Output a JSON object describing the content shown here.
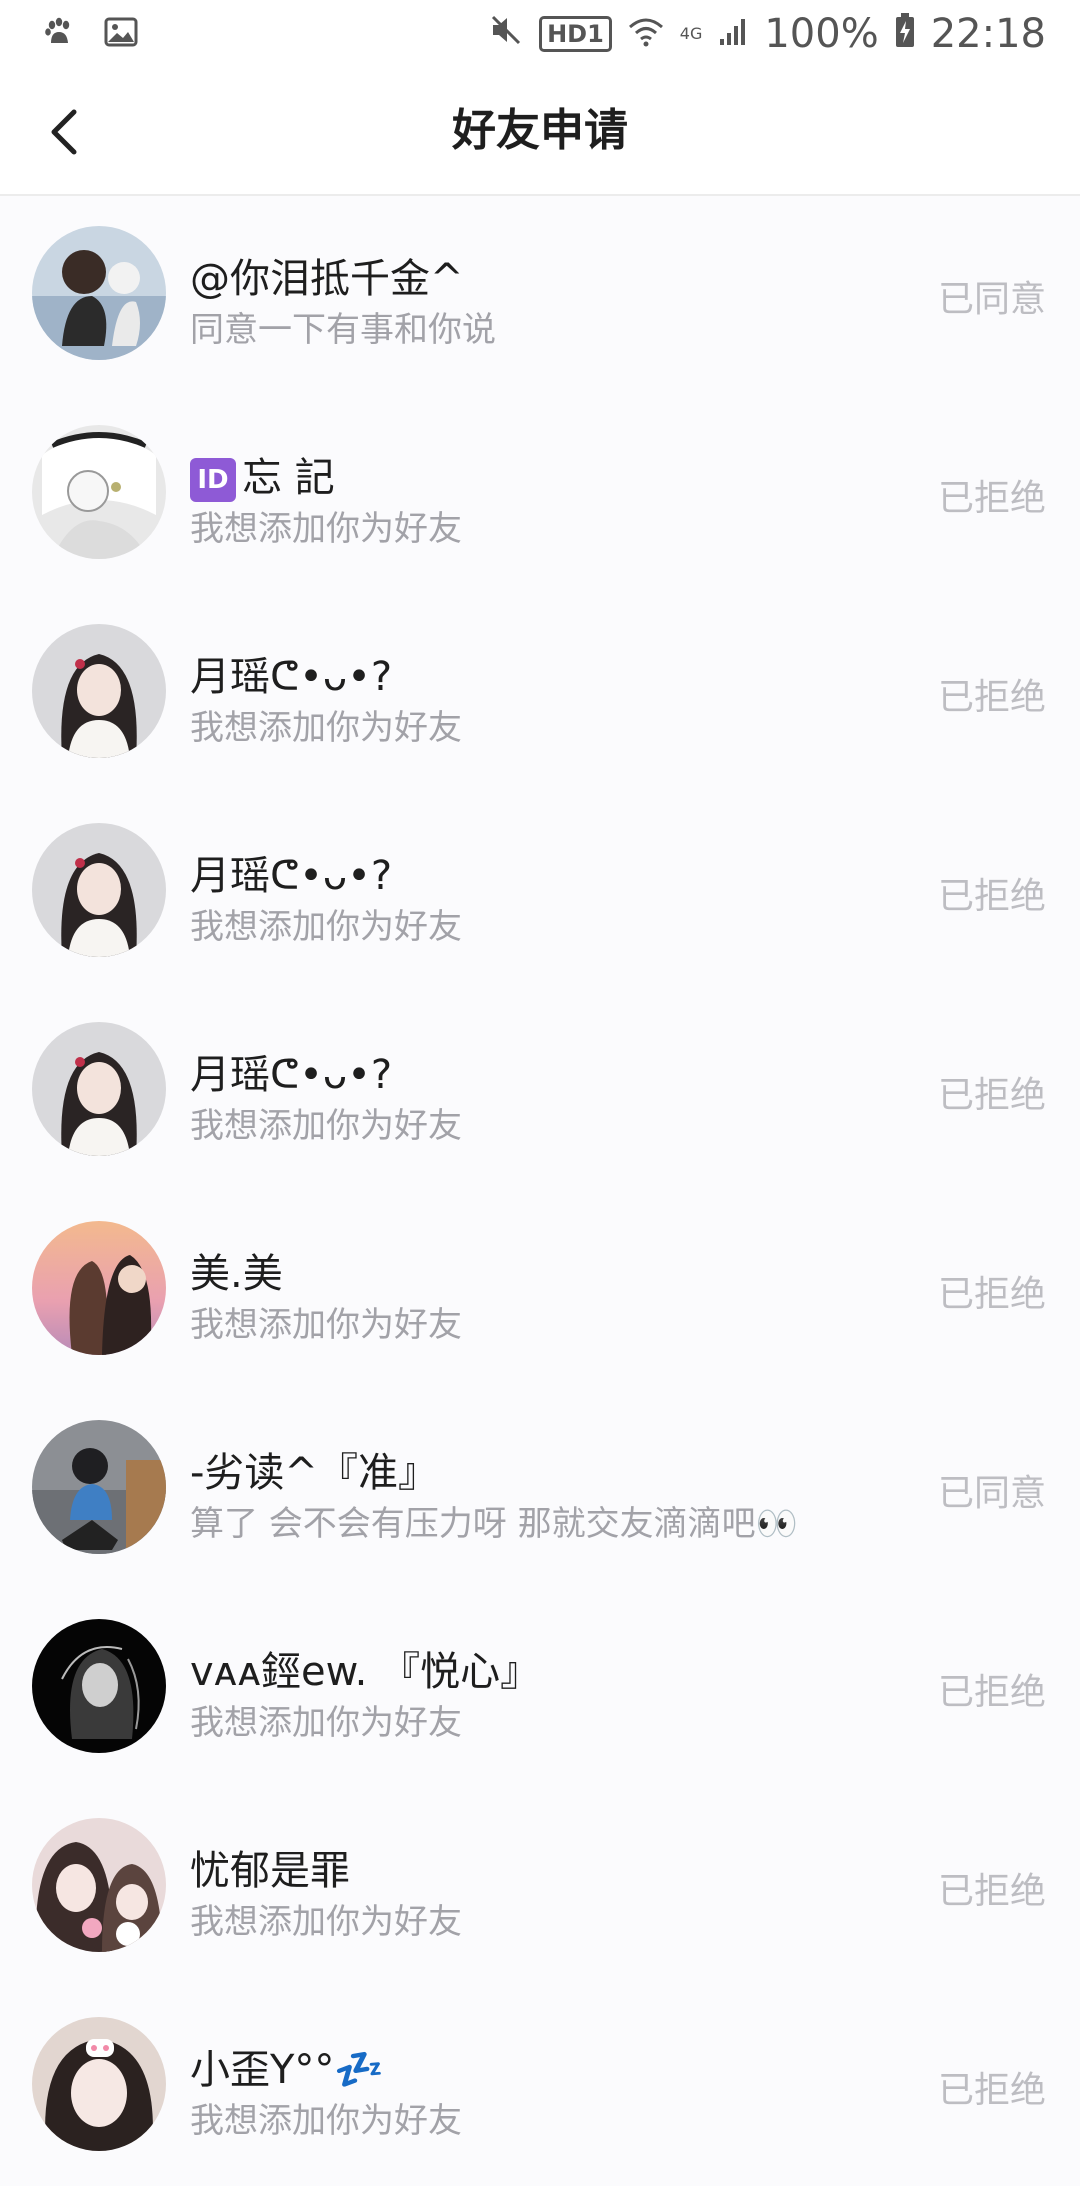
{
  "status_bar": {
    "battery": "100%",
    "time": "22:18",
    "hd_label": "HD1",
    "network_label": "4G"
  },
  "header": {
    "title": "好友申请"
  },
  "requests": [
    {
      "name": "@你泪抵千金^",
      "message": "同意一下有事和你说",
      "status": "已同意"
    },
    {
      "name": "忘 記",
      "badge": "ID",
      "message": "我想添加你为好友",
      "status": "已拒绝"
    },
    {
      "name": "月瑶ᕦ•ᴗ•?",
      "message": "我想添加你为好友",
      "status": "已拒绝"
    },
    {
      "name": "月瑶ᕦ•ᴗ•?",
      "message": "我想添加你为好友",
      "status": "已拒绝"
    },
    {
      "name": "月瑶ᕦ•ᴗ•?",
      "message": "我想添加你为好友",
      "status": "已拒绝"
    },
    {
      "name": "美.美",
      "message": "我想添加你为好友",
      "status": "已拒绝"
    },
    {
      "name": "-劣读^『准』",
      "message": "算了 会不会有压力呀 那就交友滴滴吧👀",
      "status": "已同意"
    },
    {
      "name": "ᴠᴀᴀ鋞ew. 『悦心』",
      "message": "我想添加你为好友",
      "status": "已拒绝"
    },
    {
      "name": "忧郁是罪",
      "message": "我想添加你为好友",
      "status": "已拒绝"
    },
    {
      "name": "小歪Y°°💤",
      "message": "我想添加你为好友",
      "status": "已拒绝"
    }
  ]
}
